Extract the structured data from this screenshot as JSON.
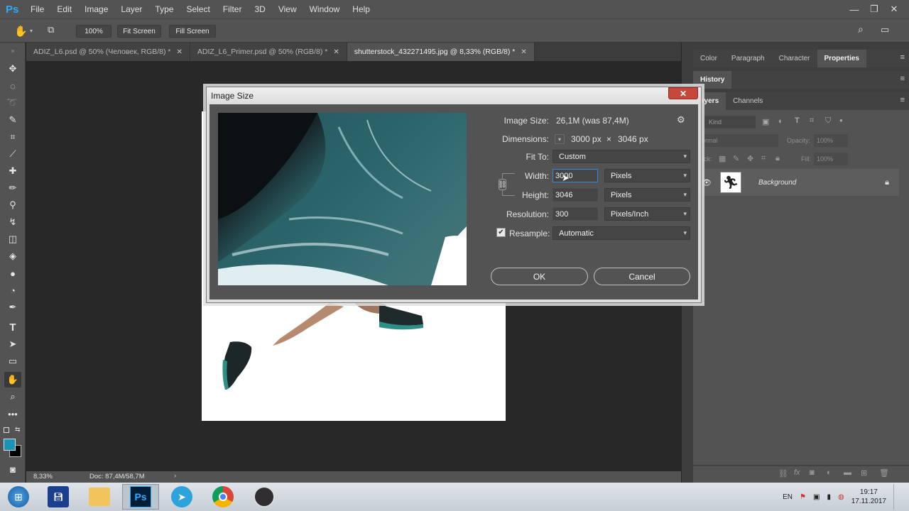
{
  "app": {
    "logo": "Ps"
  },
  "menu": [
    "File",
    "Edit",
    "Image",
    "Layer",
    "Type",
    "Select",
    "Filter",
    "3D",
    "View",
    "Window",
    "Help"
  ],
  "options_bar": {
    "zoom": "100%",
    "fit_screen": "Fit Screen",
    "fill_screen": "Fill Screen"
  },
  "tabs": [
    {
      "label": "ADIZ_L6.psd @ 50% (Человек, RGB/8) *"
    },
    {
      "label": "ADIZ_L6_Primer.psd @ 50% (RGB/8) *"
    },
    {
      "label": "shutterstock_432271495.jpg @ 8,33% (RGB/8) *"
    }
  ],
  "status": {
    "zoom": "8,33%",
    "doc": "Doc: 87,4M/58,7M"
  },
  "panels": {
    "top_tabs": [
      "Color",
      "Paragraph",
      "Character",
      "Properties"
    ],
    "history": "History",
    "layers_tabs": [
      "ayers",
      "Channels"
    ],
    "kind_placeholder": "Kind",
    "blend_mode": "ormal",
    "opacity_label": "Opacity:",
    "opacity_value": "100%",
    "lock_label": "ock:",
    "fill_label": "Fill:",
    "fill_value": "100%",
    "layer_name": "Background"
  },
  "dialog": {
    "title": "Image Size",
    "close": "✕",
    "image_size_label": "Image Size:",
    "image_size_value": "26,1M (was 87,4M)",
    "dimensions_label": "Dimensions:",
    "dimensions_w": "3000 px",
    "dimensions_x": "×",
    "dimensions_h": "3046 px",
    "fit_to_label": "Fit To:",
    "fit_to_value": "Custom",
    "width_label": "Width:",
    "width_value": "3000",
    "width_unit": "Pixels",
    "height_label": "Height:",
    "height_value": "3046",
    "height_unit": "Pixels",
    "resolution_label": "Resolution:",
    "resolution_value": "300",
    "resolution_unit": "Pixels/Inch",
    "resample_label": "Resample:",
    "resample_value": "Automatic",
    "resample_checked": true,
    "ok": "OK",
    "cancel": "Cancel"
  },
  "taskbar": {
    "apps": [
      "start",
      "save",
      "explorer",
      "photoshop",
      "telegram",
      "chrome",
      "obs"
    ],
    "photoshop_label": "Ps",
    "lang": "EN",
    "time": "19:17",
    "date": "17.11.2017"
  },
  "colors": {
    "accent": "#31a8ff",
    "foreground_swatch": "#1a93b5",
    "background_swatch": "#000000"
  }
}
